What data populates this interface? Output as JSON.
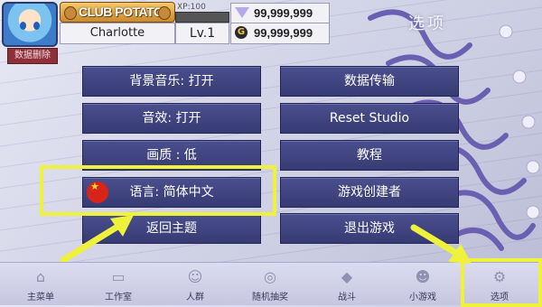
{
  "header": {
    "club_label": "CLUB POTATO",
    "player_name": "Charlotte",
    "xp_label": "XP:100",
    "level": "Lv.1",
    "gems": "99,999,999",
    "coins": "99,999,999",
    "coin_symbol": "G"
  },
  "page_title": "选项",
  "data_delete_label": "数据删除",
  "menu": {
    "bgm": "背景音乐: 打开",
    "data_transfer": "数据传输",
    "sfx": "音效: 打开",
    "reset_studio": "Reset Studio",
    "quality": "画质 : 低",
    "tutorial": "教程",
    "language": "语言: 简体中文",
    "creators": "游戏创建者",
    "return_title": "返回主题",
    "exit_game": "退出游戏"
  },
  "nav": [
    {
      "label": "主菜单",
      "icon": "home-icon"
    },
    {
      "label": "工作室",
      "icon": "studio-icon"
    },
    {
      "label": "人群",
      "icon": "crowd-icon"
    },
    {
      "label": "随机抽奖",
      "icon": "gacha-icon"
    },
    {
      "label": "战斗",
      "icon": "battle-icon"
    },
    {
      "label": "小游戏",
      "icon": "minigame-icon"
    },
    {
      "label": "选项",
      "icon": "options-icon"
    }
  ],
  "colors": {
    "highlight": "#eef23a",
    "button": "#3f4380",
    "danger": "#8e2f3a"
  }
}
